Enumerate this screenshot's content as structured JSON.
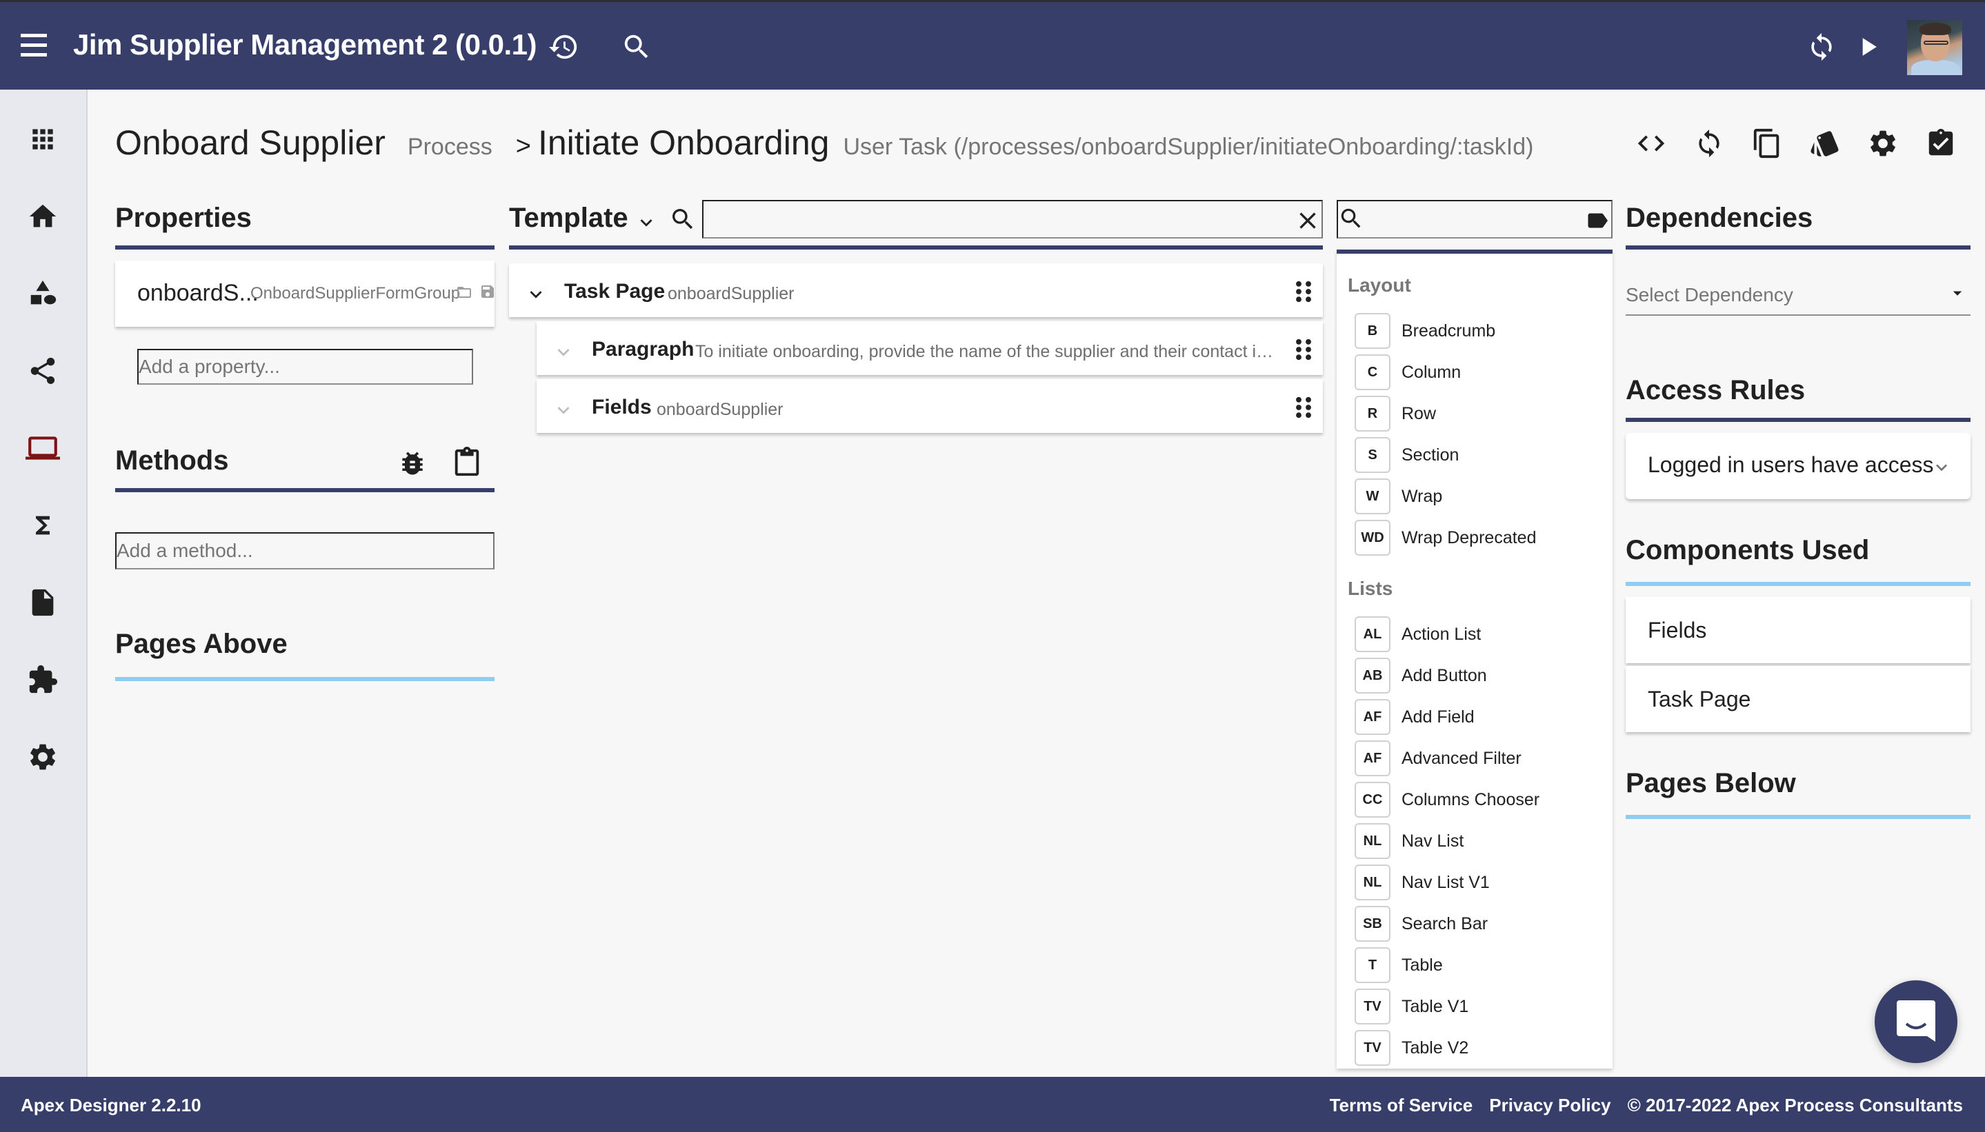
{
  "header": {
    "app_title": "Jim Supplier Management 2 (0.0.1)",
    "icons": [
      "menu-icon",
      "history-icon",
      "search-icon",
      "sync-icon",
      "play-icon",
      "user-avatar"
    ]
  },
  "sidebar": {
    "items": [
      {
        "name": "apps",
        "icon": "apps-icon",
        "active": false
      },
      {
        "name": "home",
        "icon": "home-icon",
        "active": false
      },
      {
        "name": "business-objects",
        "icon": "shapes-icon",
        "active": false
      },
      {
        "name": "processes",
        "icon": "share-icon",
        "active": false
      },
      {
        "name": "user-interfaces",
        "icon": "laptop-icon",
        "active": true
      },
      {
        "name": "business-logic",
        "icon": "sigma-icon",
        "active": false
      },
      {
        "name": "files",
        "icon": "file-icon",
        "active": false
      },
      {
        "name": "dependencies",
        "icon": "puzzle-icon",
        "active": false
      },
      {
        "name": "settings",
        "icon": "settings-icon",
        "active": false
      }
    ],
    "active_color": "#7b1414"
  },
  "title": {
    "parent_name": "Onboard Supplier",
    "parent_type": "Process",
    "separator": ">",
    "name": "Initiate Onboarding",
    "subtitle": "User Task (/processes/onboardSupplier/initiateOnboarding/:taskId)",
    "actions": [
      "code-icon",
      "sync-icon",
      "copy-icon",
      "style-icon",
      "settings-icon",
      "assignment-turned-in-icon"
    ]
  },
  "properties": {
    "heading": "Properties",
    "items": [
      {
        "name": "onboardS...",
        "type": "OnboardSupplierFormGroup"
      }
    ],
    "add_placeholder": "Add a property..."
  },
  "methods": {
    "heading": "Methods",
    "add_placeholder": "Add a method..."
  },
  "pages_above": {
    "heading": "Pages Above"
  },
  "template": {
    "heading": "Template",
    "search_value": "",
    "rows": [
      {
        "kind": "Task Page",
        "detail": "onboardSupplier",
        "level": 0,
        "expanded": true
      },
      {
        "kind": "Paragraph",
        "detail": "To initiate onboarding, provide the name of the supplier and their contact infor...",
        "level": 1,
        "expanded": false
      },
      {
        "kind": "Fields",
        "detail": "onboardSupplier",
        "level": 1,
        "expanded": false
      }
    ]
  },
  "palette": {
    "search_value": "",
    "groups": [
      {
        "label": "Layout",
        "items": [
          {
            "abbr": "B",
            "label": "Breadcrumb"
          },
          {
            "abbr": "C",
            "label": "Column"
          },
          {
            "abbr": "R",
            "label": "Row"
          },
          {
            "abbr": "S",
            "label": "Section"
          },
          {
            "abbr": "W",
            "label": "Wrap"
          },
          {
            "abbr": "WD",
            "label": "Wrap Deprecated"
          }
        ]
      },
      {
        "label": "Lists",
        "items": [
          {
            "abbr": "AL",
            "label": "Action List"
          },
          {
            "abbr": "AB",
            "label": "Add Button"
          },
          {
            "abbr": "AF",
            "label": "Add Field"
          },
          {
            "abbr": "AF",
            "label": "Advanced Filter"
          },
          {
            "abbr": "CC",
            "label": "Columns Chooser"
          },
          {
            "abbr": "NL",
            "label": "Nav List"
          },
          {
            "abbr": "NL",
            "label": "Nav List V1"
          },
          {
            "abbr": "SB",
            "label": "Search Bar"
          },
          {
            "abbr": "T",
            "label": "Table"
          },
          {
            "abbr": "TV",
            "label": "Table V1"
          },
          {
            "abbr": "TV",
            "label": "Table V2"
          }
        ]
      }
    ]
  },
  "dependencies": {
    "heading": "Dependencies",
    "select_placeholder": "Select Dependency"
  },
  "access_rules": {
    "heading": "Access Rules",
    "value": "Logged in users have access"
  },
  "components_used": {
    "heading": "Components Used",
    "items": [
      "Fields",
      "Task Page"
    ]
  },
  "pages_below": {
    "heading": "Pages Below"
  },
  "footer": {
    "version": "Apex Designer 2.2.10",
    "terms": "Terms of Service",
    "privacy": "Privacy Policy",
    "copyright": "© 2017-2022 Apex Process Consultants"
  },
  "colors": {
    "primary": "#363e69",
    "accent_light": "#8ecdee",
    "background": "#f7f7f7"
  }
}
